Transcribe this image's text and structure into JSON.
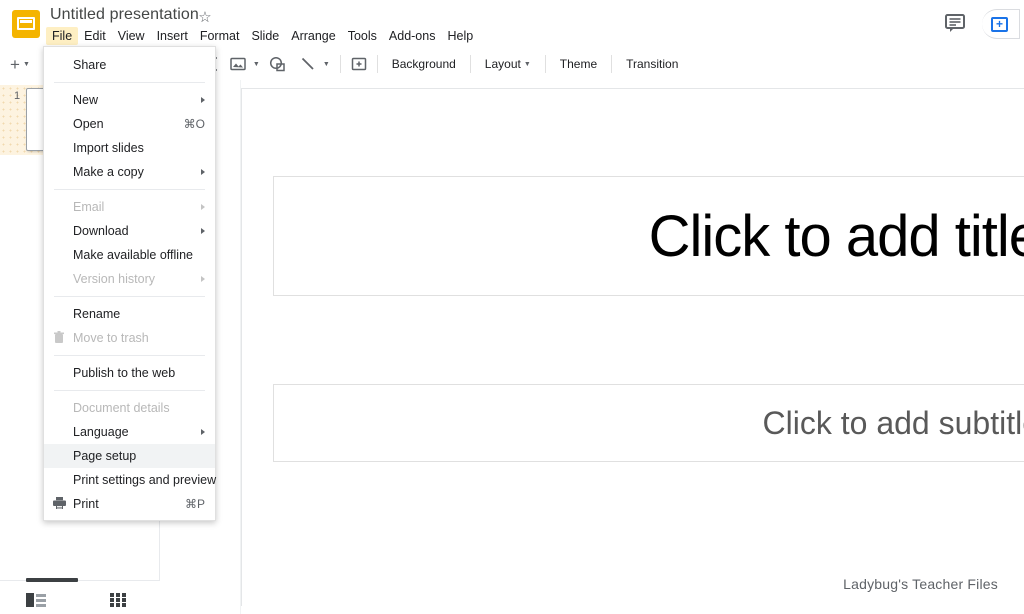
{
  "app": {
    "logo_icon": "google-slides-logo",
    "doc_title": "Untitled presentation",
    "star_icon": "☆"
  },
  "menubar": {
    "items": [
      {
        "label": "File",
        "active": true
      },
      {
        "label": "Edit",
        "active": false
      },
      {
        "label": "View",
        "active": false
      },
      {
        "label": "Insert",
        "active": false
      },
      {
        "label": "Format",
        "active": false
      },
      {
        "label": "Slide",
        "active": false
      },
      {
        "label": "Arrange",
        "active": false
      },
      {
        "label": "Tools",
        "active": false
      },
      {
        "label": "Add-ons",
        "active": false
      },
      {
        "label": "Help",
        "active": false
      }
    ]
  },
  "header_actions": {
    "comment_icon": "comment-icon",
    "present_icon": "present-share-icon"
  },
  "toolbar": {
    "new_slide_label": "+",
    "textbox_icon": "text-box-icon",
    "image_icon": "insert-image-icon",
    "shape_icon": "insert-shape-icon",
    "line_icon": "insert-line-icon",
    "comment_icon": "add-comment-icon",
    "background_label": "Background",
    "layout_label": "Layout",
    "theme_label": "Theme",
    "transition_label": "Transition"
  },
  "filmstrip": {
    "slides": [
      {
        "number": "1",
        "selected": true
      }
    ]
  },
  "bottombar": {
    "filmstrip_view_icon": "filmstrip-view-icon",
    "grid_view_icon": "grid-view-icon"
  },
  "slide": {
    "title_placeholder": "Click to add title",
    "subtitle_placeholder": "Click to add subtitle",
    "watermark": "Ladybug's Teacher Files"
  },
  "file_menu": {
    "items": [
      {
        "label": "Share",
        "accel": "",
        "arrow": false,
        "icon": "",
        "disabled": false,
        "hover": false,
        "sep_after": true
      },
      {
        "label": "New",
        "accel": "",
        "arrow": true,
        "icon": "",
        "disabled": false,
        "hover": false,
        "sep_after": false
      },
      {
        "label": "Open",
        "accel": "⌘O",
        "arrow": false,
        "icon": "",
        "disabled": false,
        "hover": false,
        "sep_after": false
      },
      {
        "label": "Import slides",
        "accel": "",
        "arrow": false,
        "icon": "",
        "disabled": false,
        "hover": false,
        "sep_after": false
      },
      {
        "label": "Make a copy",
        "accel": "",
        "arrow": true,
        "icon": "",
        "disabled": false,
        "hover": false,
        "sep_after": true
      },
      {
        "label": "Email",
        "accel": "",
        "arrow": true,
        "icon": "",
        "disabled": true,
        "hover": false,
        "sep_after": false
      },
      {
        "label": "Download",
        "accel": "",
        "arrow": true,
        "icon": "",
        "disabled": false,
        "hover": false,
        "sep_after": false
      },
      {
        "label": "Make available offline",
        "accel": "",
        "arrow": false,
        "icon": "",
        "disabled": false,
        "hover": false,
        "sep_after": false
      },
      {
        "label": "Version history",
        "accel": "",
        "arrow": true,
        "icon": "",
        "disabled": true,
        "hover": false,
        "sep_after": true
      },
      {
        "label": "Rename",
        "accel": "",
        "arrow": false,
        "icon": "",
        "disabled": false,
        "hover": false,
        "sep_after": false
      },
      {
        "label": "Move to trash",
        "accel": "",
        "arrow": false,
        "icon": "trash-icon",
        "disabled": true,
        "hover": false,
        "sep_after": true
      },
      {
        "label": "Publish to the web",
        "accel": "",
        "arrow": false,
        "icon": "",
        "disabled": false,
        "hover": false,
        "sep_after": true
      },
      {
        "label": "Document details",
        "accel": "",
        "arrow": false,
        "icon": "",
        "disabled": true,
        "hover": false,
        "sep_after": false
      },
      {
        "label": "Language",
        "accel": "",
        "arrow": true,
        "icon": "",
        "disabled": false,
        "hover": false,
        "sep_after": false
      },
      {
        "label": "Page setup",
        "accel": "",
        "arrow": false,
        "icon": "",
        "disabled": false,
        "hover": true,
        "sep_after": false
      },
      {
        "label": "Print settings and preview",
        "accel": "",
        "arrow": false,
        "icon": "",
        "disabled": false,
        "hover": false,
        "sep_after": false
      },
      {
        "label": "Print",
        "accel": "⌘P",
        "arrow": false,
        "icon": "printer-icon",
        "disabled": false,
        "hover": false,
        "sep_after": false
      }
    ]
  },
  "colors": {
    "brand_yellow": "#F4B400",
    "accent_blue": "#1a73e8",
    "menu_highlight": "#feefc3",
    "thumb_selected_bg": "#fdf3e0"
  }
}
